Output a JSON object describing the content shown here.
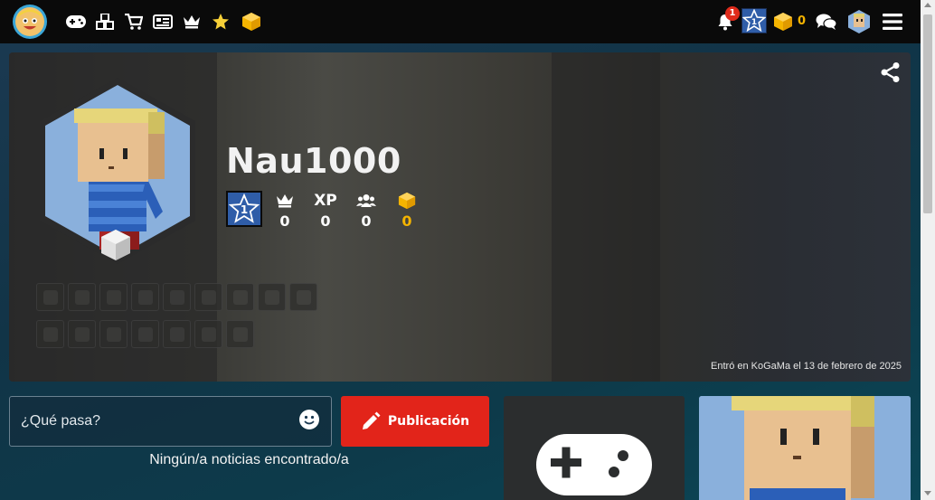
{
  "nav": {
    "icons": [
      "logo-icon",
      "gamepad-icon",
      "cubes-icon",
      "cart-icon",
      "news-icon",
      "crown-icon",
      "star-icon",
      "gold-cube-icon"
    ],
    "notifications_count": "1",
    "level": "1",
    "gold": "0"
  },
  "profile": {
    "username": "Nau1000",
    "level": "1",
    "stats": {
      "crown": "0",
      "xp_label": "XP",
      "xp": "0",
      "friends": "0",
      "gold": "0"
    },
    "joined_text": "Entró en KoGaMa el 13 de febrero de 2025"
  },
  "feed": {
    "placeholder": "¿Qué pasa?",
    "publish_label": "Publicación",
    "empty_text": "Ningún/a noticias encontrado/a"
  },
  "colors": {
    "accent_red": "#e2241a",
    "gold": "#f5b400",
    "level_blue": "#2f5da8"
  }
}
